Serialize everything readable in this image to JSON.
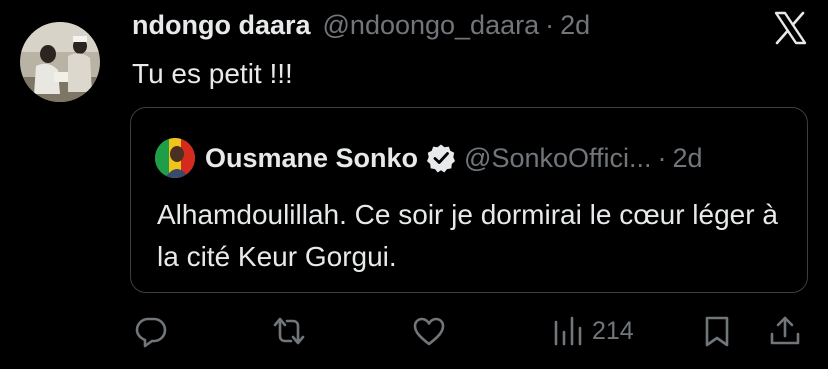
{
  "tweet": {
    "display_name": "ndongo daara",
    "handle": "@ndoongo_daara",
    "separator": "·",
    "time": "2d",
    "text": "Tu es petit !!!"
  },
  "quoted_tweet": {
    "display_name": "Ousmane Sonko",
    "handle": "@SonkoOffici...",
    "separator": "·",
    "time": "2d",
    "text": "Alhamdoulillah. Ce soir je dormirai le cœur léger à la cité Keur Gorgui.",
    "verified_icon": "verified-badge-icon"
  },
  "actions": {
    "reply_icon": "reply-icon",
    "retweet_icon": "retweet-icon",
    "like_icon": "heart-icon",
    "views_icon": "views-icon",
    "views_count": "214",
    "bookmark_icon": "bookmark-icon",
    "share_icon": "share-icon"
  },
  "colors": {
    "background": "#000000",
    "text": "#e7e9ea",
    "secondary_text": "#71767b",
    "verified": "#1d9bf0",
    "border": "#3a3d41"
  }
}
